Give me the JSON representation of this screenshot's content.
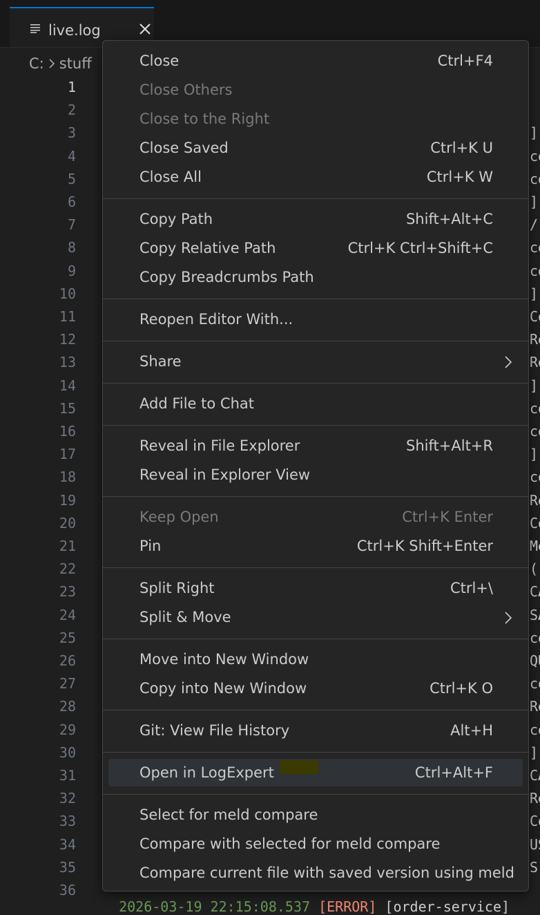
{
  "tab": {
    "label": "live.log"
  },
  "breadcrumb": {
    "drive": "C:",
    "folder": "stuff"
  },
  "line_numbers": [
    "1",
    "2",
    "3",
    "4",
    "5",
    "6",
    "7",
    "8",
    "9",
    "10",
    "11",
    "12",
    "13",
    "14",
    "15",
    "16",
    "17",
    "18",
    "19",
    "20",
    "21",
    "22",
    "23",
    "24",
    "25",
    "26",
    "27",
    "28",
    "29",
    "30",
    "31",
    "32",
    "33",
    "34",
    "35",
    "36"
  ],
  "code_fragments": [
    "",
    "",
    "]",
    "co",
    "co",
    "]",
    "/",
    "co",
    "co",
    "]",
    "Co",
    "Re",
    "Re",
    "]",
    "co",
    "co",
    "]",
    "co",
    "Re",
    "Co",
    "Me",
    "(",
    "CA",
    "SA",
    "co",
    "QU",
    "co",
    "Re",
    "co",
    "]",
    "CA",
    "Re",
    "Co",
    "US",
    "S"
  ],
  "last_line": {
    "timestamp": "2026-03-19 22:15:08.537 ",
    "level": "[ERROR]",
    "source": " [order-service]"
  },
  "menu": {
    "groups": [
      [
        {
          "label": "Close",
          "shortcut": "Ctrl+F4"
        },
        {
          "label": "Close Others",
          "shortcut": "",
          "disabled": true
        },
        {
          "label": "Close to the Right",
          "shortcut": "",
          "disabled": true
        },
        {
          "label": "Close Saved",
          "shortcut": "Ctrl+K U"
        },
        {
          "label": "Close All",
          "shortcut": "Ctrl+K W"
        }
      ],
      [
        {
          "label": "Copy Path",
          "shortcut": "Shift+Alt+C"
        },
        {
          "label": "Copy Relative Path",
          "shortcut": "Ctrl+K Ctrl+Shift+C"
        },
        {
          "label": "Copy Breadcrumbs Path",
          "shortcut": ""
        }
      ],
      [
        {
          "label": "Reopen Editor With...",
          "shortcut": ""
        }
      ],
      [
        {
          "label": "Share",
          "shortcut": "",
          "submenu": true
        }
      ],
      [
        {
          "label": "Add File to Chat",
          "shortcut": ""
        }
      ],
      [
        {
          "label": "Reveal in File Explorer",
          "shortcut": "Shift+Alt+R"
        },
        {
          "label": "Reveal in Explorer View",
          "shortcut": ""
        }
      ],
      [
        {
          "label": "Keep Open",
          "shortcut": "Ctrl+K Enter",
          "disabled": true
        },
        {
          "label": "Pin",
          "shortcut": "Ctrl+K Shift+Enter"
        }
      ],
      [
        {
          "label": "Split Right",
          "shortcut": "Ctrl+\\"
        },
        {
          "label": "Split & Move",
          "shortcut": "",
          "submenu": true
        }
      ],
      [
        {
          "label": "Move into New Window",
          "shortcut": ""
        },
        {
          "label": "Copy into New Window",
          "shortcut": "Ctrl+K O"
        }
      ],
      [
        {
          "label": "Git: View File History",
          "shortcut": "Alt+H"
        }
      ],
      [
        {
          "label": "Open in LogExpert",
          "shortcut": "Ctrl+Alt+F",
          "selected": true
        }
      ],
      [
        {
          "label": "Select for meld compare",
          "shortcut": ""
        },
        {
          "label": "Compare with selected for meld compare",
          "shortcut": ""
        },
        {
          "label": "Compare current file with saved version using meld",
          "shortcut": ""
        }
      ]
    ]
  },
  "colors": {
    "accent": "#0078d4",
    "menu_bg": "#252526",
    "editor_bg": "#1f1f1f",
    "selected_bg": "#2f3236"
  }
}
